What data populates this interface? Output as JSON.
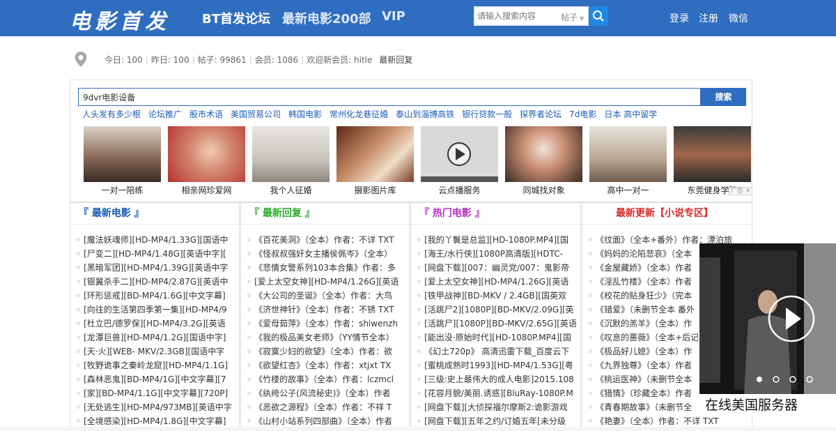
{
  "header": {
    "logo": "电影首发",
    "nav": [
      "BT首发论坛",
      "最新电影200部",
      "VIP"
    ],
    "search_placeholder": "请输入搜索内容",
    "search_type": "帖子",
    "links": [
      "登录",
      "注册",
      "微信"
    ]
  },
  "stats": {
    "today": "今日: 100",
    "yesterday": "昨日: 100",
    "posts": "帖子: 99861",
    "members": "会员: 1086",
    "welcome": "欢迎新会员: hitle",
    "latest": "最新回复"
  },
  "search": {
    "value": "9dvr电影设备",
    "button": "搜索",
    "hot": [
      "人头发有多少根",
      "论坛推广",
      "股市术语",
      "美国贸易公司",
      "韩国电影",
      "常州化龙巷征婚",
      "泰山到淄博高铁",
      "银行贷款一般",
      "探界者论坛",
      "7d电影",
      "日本 高中留学"
    ]
  },
  "thumbs": [
    "一对一陪练",
    "相亲网珍爱网",
    "我个人征婚",
    "摄影图片库",
    "云点播服务",
    "同城找对象",
    "高中一对一",
    "东莞健身学院"
  ],
  "ad_tag": "广告",
  "columns": [
    {
      "title": "『 最新电影 』",
      "items": [
        "[魔法妖魂师][HD-MP4/1.33G][国语中",
        "[尸变二][HD-MP4/1.48G][英语中字][",
        "[黑暗军团][HD-MP4/1.39G][英语中字",
        "[银翼杀手二][HD-MP4/2.87G][英语中",
        "[环形惩戒][BD-MP4/1.6G][中文字幕]",
        "[向往的生活第四季第一集][HD-MP4/9",
        "[杜立巴/德罗保][HD-MP4/3.2G][英语",
        "[龙潭巨兽][HD-MP4/1.2G][国语中字]",
        "[天·火][WEB- MKV/2.3GB][国语中字",
        "[牧野诡事之秦岭龙窟][HD-MP4/1.1G]",
        "[森林恶鬼][BD-MP4/1G][中文字幕][7",
        "[家][BD-MP4/1.1G][中文字幕][720P]",
        "[无处逃生][HD-MP4/973MB][英语中字",
        "[全境感染][HD-MP4/1.8G][中文字幕]"
      ]
    },
    {
      "title": "『 最新回复 』",
      "items": [
        "《百花美洞》（全本）作者：不详 TXT",
        "《怪叔叔强奸女主播侯佩岑》（全本）",
        "《悲情女警系列103本合集》作者：多",
        "[爱上太空女神][HD-MP4/1.26G][英语",
        "《大公司的圣诞》（全本）作者：大鸟",
        "《济世神针》（全本）作者：不锈 TXT",
        "《爱母茹萍》（全本）作者：shiwenzh",
        "《我的极品美女老师》（YY情节全本）",
        "《寂寞少妇的欲望》（全本）作者：欲",
        "《欲望红杏》（全本）作者：xtjxt TX",
        "《竹楼的故事》（全本）作者：lczmcl",
        "《纨绔公子(风流秘史)》（全本）作者",
        "《恶欲之源程》（全本）作者：不祥 T",
        "《山村小站系列四部曲》（全本）作者"
      ]
    },
    {
      "title": "『 热门电影 』",
      "items": [
        "[我的丫鬟是总监][HD-1080P.MP4][国",
        "[海王/水行侠][1080P高清版][HDTC-",
        "[网盘下载][007：幽灵党/007：鬼影帝",
        "[爱上太空女神][HD-MP4/1.26G][英语",
        "[铁甲战神][BD-MKV / 2.4GB][国英双",
        "[活跳尸2][1080P][BD-MKV/2.09G][英",
        "[活跳尸][1080P][BD-MKV/2.65G][英语",
        "[能出没·原始时代][HD-1080P.MP4][国",
        "《幻土720p》 高清迅雷下载_百度云下",
        "[蜜桃成熟时1993][HD-MP4/1.53G][粤",
        "[三级:史上最伟大的成人电影]2015.108",
        "[花容月貌/美丽.诱惑][BluRay-1080P.M",
        "[网盘下载][大侦探福尔摩斯2:诡影游戏",
        "[网盘下载][五年之约/订婚五年[未分级"
      ]
    },
    {
      "title": "最新更新【小说专区】",
      "items": [
        "《纹面》（全本+番外）作者：漂泊旅",
        "《妈妈的沦陷悲哀》（全本",
        "《金屋藏娇》（全本）作者",
        "《淫乱竹楼》（全本）作者",
        "《校花的贴身狂少》（完本",
        "《错爱》（未删节全本 番外",
        "《沉默的羔羊》（全本）作",
        "《叹息的蔷薇》（全本+后记",
        "《极品好儿媳》（全本）作",
        "《九界独尊》（全本）作者",
        "《桃运医神》（未删节全本",
        "《猎情》（珍藏全本）作者",
        "《青春期故事》（未删节全",
        "《艳妻》（全本）作者：不详 TXT"
      ]
    }
  ],
  "video_ad": {
    "caption": "在线美国服务器"
  },
  "colors": {
    "brand": "#2f6dc0",
    "col1": "#1a5bb5",
    "col2": "#2fa82f",
    "col3": "#b52fc0",
    "col4": "#d92b2b"
  }
}
